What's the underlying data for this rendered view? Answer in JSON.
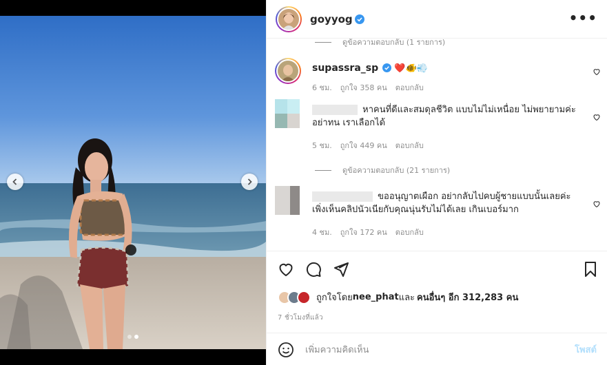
{
  "post": {
    "username": "goyyog",
    "more_label": "•••"
  },
  "comments_area": {
    "top_reply_toggle": "ดูข้อความตอบกลับ (1 รายการ)",
    "comment1": {
      "username": "supassra_sp",
      "emojis": "❤️🐠💨",
      "time": "6 ชม.",
      "likes": "ถูกใจ 358 คน",
      "reply": "ตอบกลับ"
    },
    "comment2": {
      "text": "หาคนที่ดีและสมดุลชีวิต แบบไม่ไม่เหนื่อย ไม่พยายามค่ะ อย่าทน เราเลือกได้",
      "time": "5 ชม.",
      "likes": "ถูกใจ 449 คน",
      "reply": "ตอบกลับ"
    },
    "reply_toggle2": "ดูข้อความตอบกลับ (21 รายการ)",
    "comment3": {
      "text": "ขออนุญาตเผือก อย่ากลับไปคบผู้ชายแบบนั้นเลยค่ะ เพิ่งเห็นคลิปนัวเนียกับคุณนุ่นรับไม่ได้เลย เกินเบอร์มาก",
      "time": "4 ชม.",
      "likes": "ถูกใจ 172 คน",
      "reply": "ตอบกลับ"
    }
  },
  "likes_line": {
    "prefix": "ถูกใจโดย ",
    "liker": "nee_phat",
    "middle": " และ",
    "others": "คนอื่นๆ อีก 312,283 คน"
  },
  "timestamp": "7 ชั่วโมงที่แล้ว",
  "add_comment": {
    "placeholder": "เพิ่มความคิดเห็น",
    "post_label": "โพสต์"
  },
  "colors": {
    "accent": "#0095f6",
    "verified": "#3897f0",
    "muted": "#8e8e8e"
  },
  "carousel": {
    "current": 2,
    "total": 2
  }
}
